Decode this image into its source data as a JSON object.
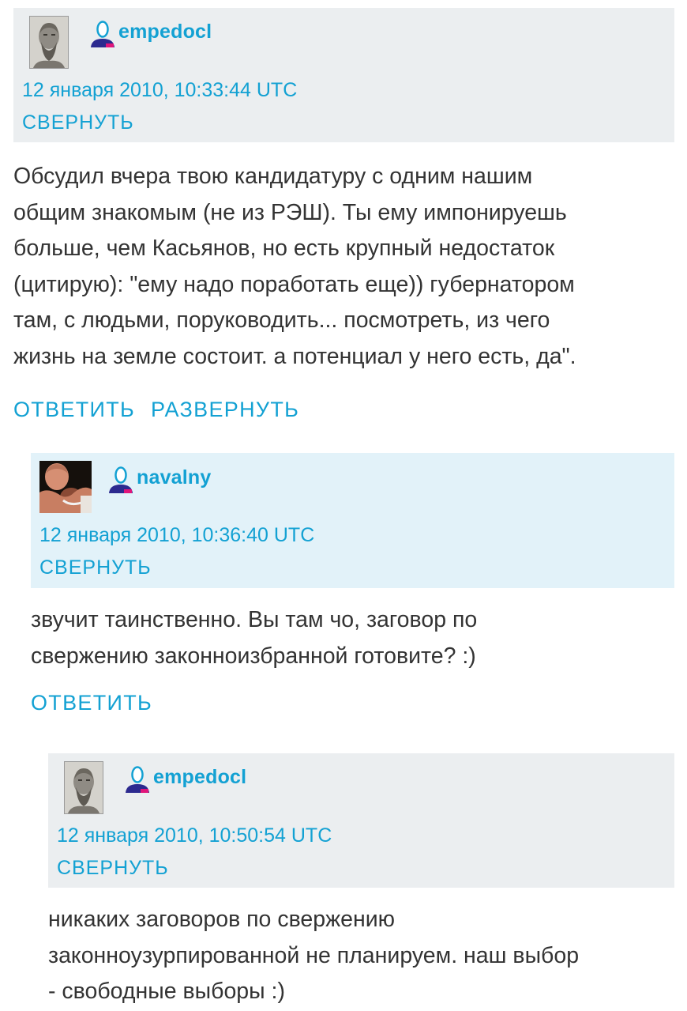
{
  "comments": [
    {
      "username": "empedocl",
      "avatar": "bust-statue-avatar",
      "date": "12 января 2010, 10:33:44 UTC",
      "collapse_label": "СВЕРНУТЬ",
      "body_lines": [
        "Обсудил вчера твою кандидатуру с одним нашим",
        "общим знакомым (не из РЭШ). Ты ему импонируешь",
        "больше, чем Касьянов, но есть крупный недостаток",
        "(цитирую): \"ему надо поработать еще)) губернатором",
        "там, с людьми, поруководить... посмотреть, из чего",
        "жизнь на земле состоит. а потенциал у него есть, да\"."
      ],
      "actions": [
        "ОТВЕТИТЬ",
        "РАЗВЕРНУТЬ"
      ]
    },
    {
      "username": "navalny",
      "avatar": "wrestlers-photo-avatar",
      "date": "12 января 2010, 10:36:40 UTC",
      "collapse_label": "СВЕРНУТЬ",
      "body_lines": [
        "звучит таинственно. Вы там чо, заговор по",
        "свержению законноизбранной готовите? :)"
      ],
      "actions": [
        "ОТВЕТИТЬ"
      ]
    },
    {
      "username": "empedocl",
      "avatar": "bust-statue-avatar",
      "date": "12 января 2010, 10:50:54 UTC",
      "collapse_label": "СВЕРНУТЬ",
      "body_lines": [
        "никаких заговоров по свержению",
        "законноузурпированной не планируем. наш выбор",
        "- свободные выборы :)"
      ],
      "actions": []
    }
  ],
  "colors": {
    "link": "#13a1d3",
    "header_gray": "#ebeef0",
    "header_highlight": "#e2f2f9",
    "text": "#333333"
  },
  "icons": {
    "user": "user-profile-icon"
  }
}
